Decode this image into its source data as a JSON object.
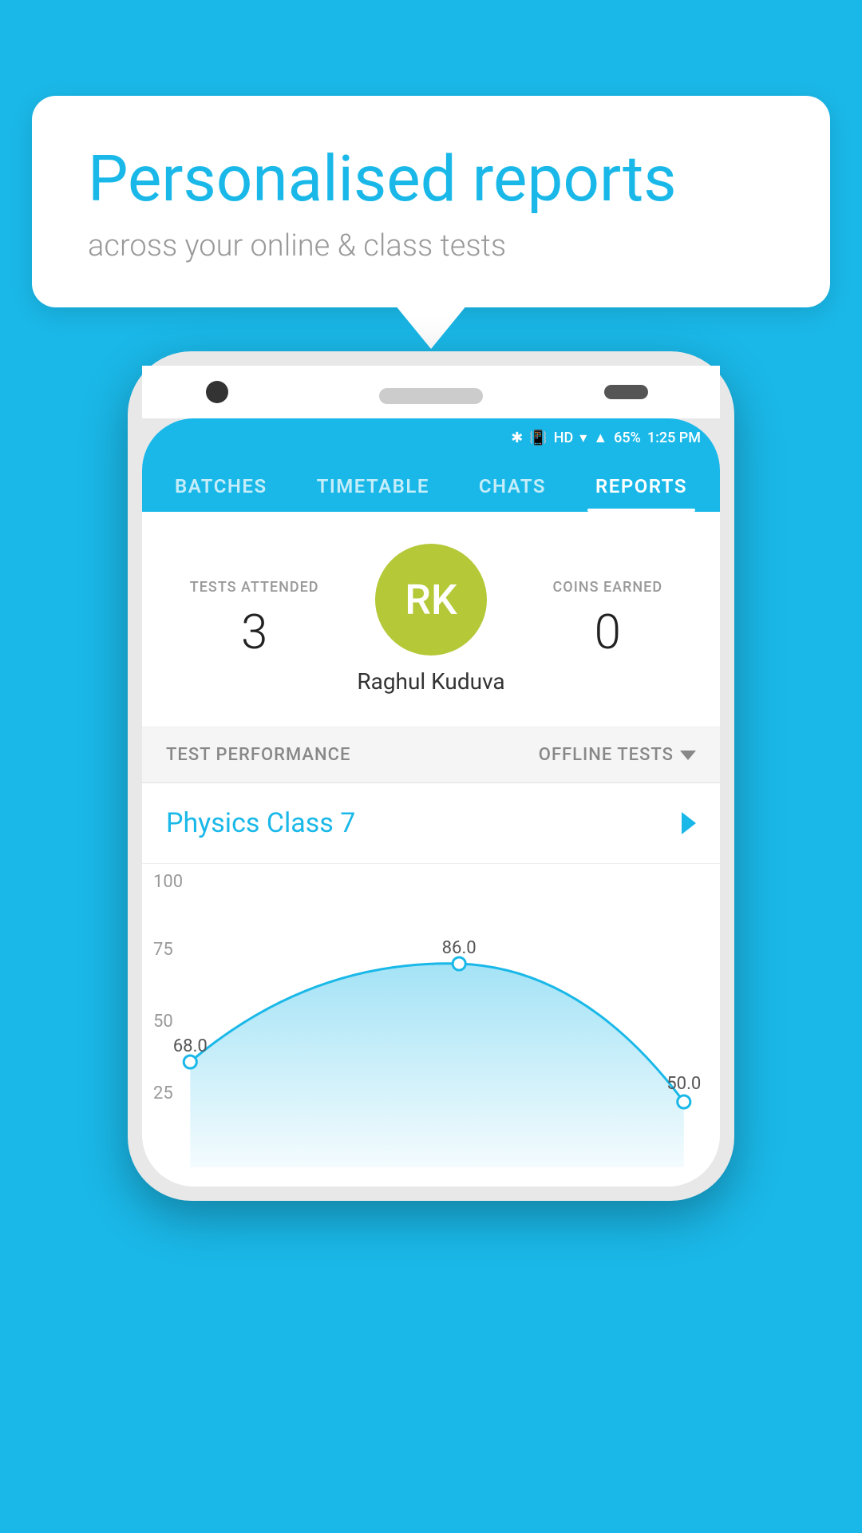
{
  "bubble": {
    "title": "Personalised reports",
    "subtitle": "across your online & class tests"
  },
  "statusBar": {
    "battery": "65%",
    "time": "1:25 PM",
    "network": "HD"
  },
  "navTabs": [
    {
      "id": "batches",
      "label": "BATCHES",
      "active": false
    },
    {
      "id": "timetable",
      "label": "TIMETABLE",
      "active": false
    },
    {
      "id": "chats",
      "label": "CHATS",
      "active": false
    },
    {
      "id": "reports",
      "label": "REPORTS",
      "active": true
    }
  ],
  "profile": {
    "avatar_initials": "RK",
    "name": "Raghul Kuduva",
    "tests_attended_label": "TESTS ATTENDED",
    "tests_attended_value": "3",
    "coins_earned_label": "COINS EARNED",
    "coins_earned_value": "0"
  },
  "performance": {
    "section_label": "TEST PERFORMANCE",
    "dropdown_label": "OFFLINE TESTS",
    "class_name": "Physics Class 7"
  },
  "chart": {
    "y_labels": [
      "100",
      "75",
      "50",
      "25"
    ],
    "points": [
      {
        "x": 0.05,
        "y": 68.0,
        "label": "68.0"
      },
      {
        "x": 0.5,
        "y": 86.0,
        "label": "86.0"
      },
      {
        "x": 0.95,
        "y": 50.0,
        "label": "50.0"
      }
    ]
  }
}
